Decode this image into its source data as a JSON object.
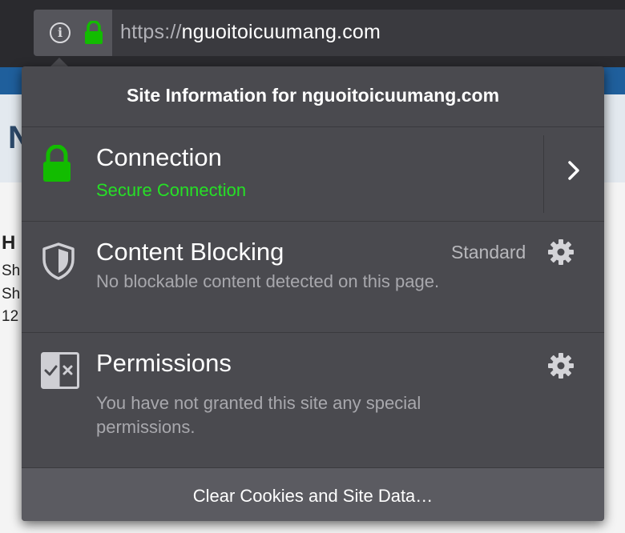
{
  "urlbar": {
    "scheme": "https://",
    "host": "nguoitoicuumang.com"
  },
  "background_page": {
    "fragments": [
      "N",
      "H",
      "Sh",
      "Sh",
      "12"
    ]
  },
  "panel": {
    "title": "Site Information for nguoitoicuumang.com",
    "connection": {
      "title": "Connection",
      "status": "Secure Connection",
      "status_color": "#26e026"
    },
    "content_blocking": {
      "title": "Content Blocking",
      "level": "Standard",
      "description": "No blockable content detected on this page."
    },
    "permissions": {
      "title": "Permissions",
      "description": "You have not granted this site any special permissions."
    },
    "footer_button": "Clear Cookies and Site Data…"
  },
  "icons": {
    "info": "info-icon",
    "lock": "lock-icon",
    "shield": "shield-icon",
    "permissions": "permissions-icon",
    "gear": "gear-icon",
    "chevron": "chevron-right-icon"
  }
}
